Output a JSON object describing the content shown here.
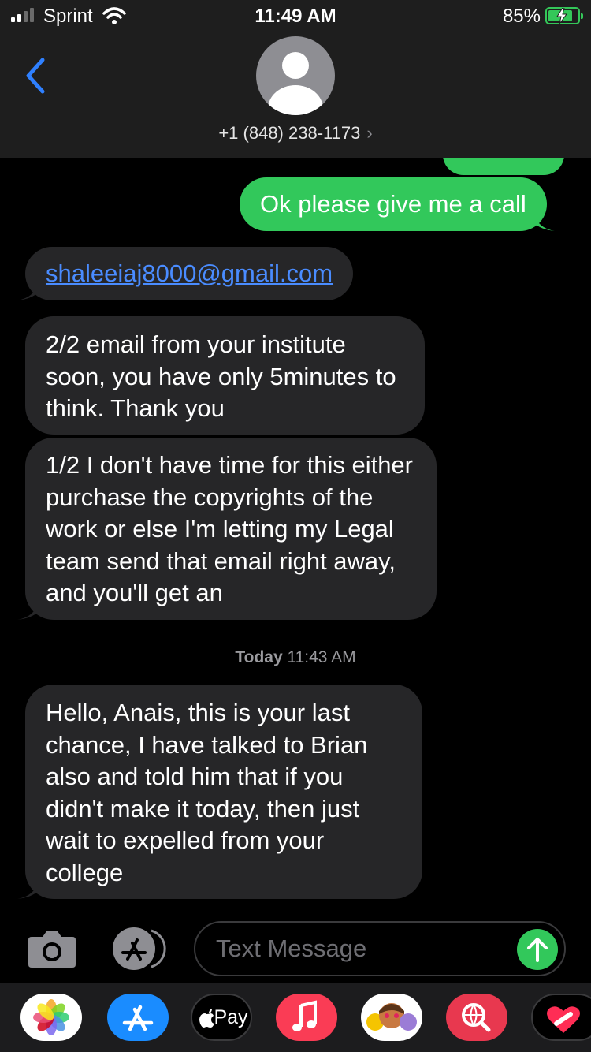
{
  "status_bar": {
    "carrier": "Sprint",
    "time": "11:49 AM",
    "battery_percent": "85%"
  },
  "header": {
    "contact": "+1 (848) 238-1173",
    "chevron": "›"
  },
  "messages": {
    "out_1": "Ok please give me a call",
    "in_1": "shaleeiaj8000@gmail.com",
    "in_2": "2/2 email from your institute soon, you have only 5minutes to think. Thank you",
    "in_3": "1/2 I don't have time for this either purchase the copyrights of the work or else I'm letting my Legal team send that email right away, and you'll get an",
    "timestamp_day": "Today",
    "timestamp_time": "11:43 AM",
    "in_4": "Hello, Anais, this is your last chance, I have talked to Brian also and told him that if you didn't make it today, then just wait to expelled from your college"
  },
  "compose": {
    "placeholder": "Text Message"
  },
  "tray": {
    "apple_pay_label": "Pay",
    "apps": [
      "photos-icon",
      "app-store-icon",
      "apple-pay-icon",
      "music-icon",
      "memoji-icon",
      "web-search-icon",
      "digital-touch-icon"
    ]
  },
  "colors": {
    "outgoing_bubble": "#32c85b",
    "incoming_bubble": "#262628",
    "link": "#4a8cff",
    "battery": "#34c759",
    "back_chevron": "#2f80ff"
  }
}
